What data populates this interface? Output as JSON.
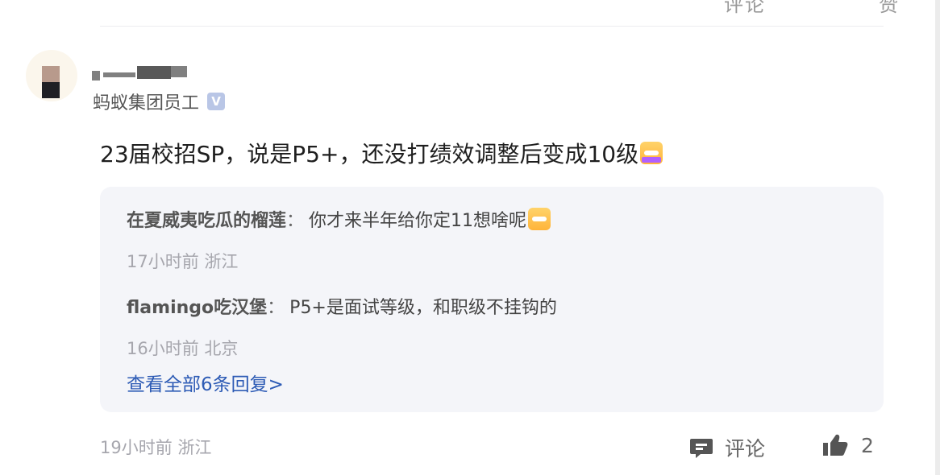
{
  "top_row": {
    "fragments": [
      "评",
      "论",
      "赞"
    ]
  },
  "comment": {
    "user_title": "蚂蚁集团员工",
    "verified_badge": "V",
    "text": "23届校招SP，说是P5+，还没打绩效调整后变成10级",
    "time": "19小时前",
    "location": "浙江",
    "comment_label": "评论",
    "like_count": "2"
  },
  "replies": [
    {
      "name": "在夏威夷吃瓜的榴莲",
      "separator": "：",
      "text": "你才来半年给你定11想啥呢",
      "time": "17小时前",
      "location": "浙江"
    },
    {
      "name": "flamingo吃汉堡",
      "separator": "：",
      "text": "P5+是面试等级，和职级不挂钩的",
      "time": "16小时前",
      "location": "北京"
    }
  ],
  "see_all_label": "查看全部6条回复>",
  "colors": {
    "link": "#2d5bb5",
    "reply_bg": "#f4f5f9",
    "muted": "#a6a6ad",
    "verify": "#b9c6e6"
  }
}
